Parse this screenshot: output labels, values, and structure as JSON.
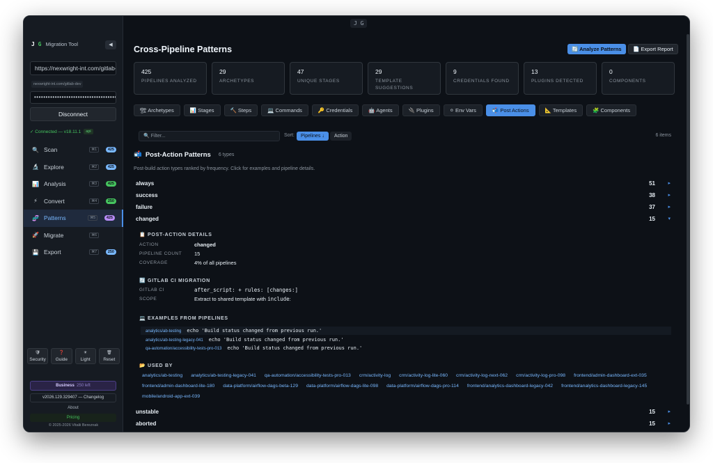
{
  "window": {
    "badge": "J G"
  },
  "sidebar": {
    "brand_logo_j": "J",
    "brand_logo_g": "G",
    "brand_name": "Migration Tool",
    "collapse": "◀",
    "url_value": "https://nexwright-int.com/gitlab-dev",
    "url_hint": "nexwright-int.com/gitlab-dev",
    "token_value": "•••••••••••••••••••••••••••••••••••••",
    "disconnect_label": "Disconnect",
    "status_text": "✓ Connected — v18.11.1",
    "status_badge": "api",
    "items": [
      {
        "label": "Scan",
        "icon": "🔍",
        "kbd": "⌘1",
        "count": "425",
        "color": "#79b8ff"
      },
      {
        "label": "Explore",
        "icon": "🔬",
        "kbd": "⌘2",
        "count": "425",
        "color": "#79b8ff"
      },
      {
        "label": "Analysis",
        "icon": "📊",
        "kbd": "⌘3",
        "count": "425",
        "color": "#46c45f"
      },
      {
        "label": "Convert",
        "icon": "⚡",
        "kbd": "⌘4",
        "count": "250",
        "color": "#46c45f"
      },
      {
        "label": "Patterns",
        "icon": "🧬",
        "kbd": "⌘5",
        "count": "425",
        "color": "#b78cf7"
      },
      {
        "label": "Migrate",
        "icon": "🚀",
        "kbd": "⌘6",
        "count": "",
        "color": ""
      },
      {
        "label": "Export",
        "icon": "💾",
        "kbd": "⌘7",
        "count": "250",
        "color": "#79b8ff"
      }
    ],
    "tools": [
      {
        "icon": "🛡",
        "label": "Security"
      },
      {
        "icon": "❓",
        "label": "Guide"
      },
      {
        "icon": "☀",
        "label": "Light"
      },
      {
        "icon": "🗑",
        "label": "Reset"
      }
    ],
    "plan_name": "Business",
    "plan_left": "250 left",
    "version": "v2026.129.329407 — Changelog",
    "about": "About",
    "pricing": "Pricing",
    "copyright": "© 2025-2026 Vitalii Bereznak"
  },
  "header": {
    "title": "Cross-Pipeline Patterns",
    "analyze_label": "🔄 Analyze Patterns",
    "export_label": "📄 Export Report"
  },
  "stats": [
    {
      "value": "425",
      "label": "PIPELINES ANALYZED"
    },
    {
      "value": "29",
      "label": "ARCHETYPES"
    },
    {
      "value": "47",
      "label": "UNIQUE STAGES"
    },
    {
      "value": "29",
      "label": "TEMPLATE SUGGESTIONS"
    },
    {
      "value": "9",
      "label": "CREDENTIALS FOUND"
    },
    {
      "value": "13",
      "label": "PLUGINS DETECTED"
    },
    {
      "value": "0",
      "label": "COMPONENTS"
    }
  ],
  "tabs": [
    {
      "label": "🏗 Archetypes"
    },
    {
      "label": "📊 Stages"
    },
    {
      "label": "🔨 Steps"
    },
    {
      "label": "💻 Commands"
    },
    {
      "label": "🔑 Credentials"
    },
    {
      "label": "🤖 Agents"
    },
    {
      "label": "🔌 Plugins"
    },
    {
      "label": "⚪ Env Vars"
    },
    {
      "label": "📬 Post Actions"
    },
    {
      "label": "📐 Templates"
    },
    {
      "label": "🧩 Components"
    }
  ],
  "filter": {
    "placeholder": "🔍 Filter...",
    "sort_label": "Sort:",
    "sort_pipelines": "Pipelines ↓",
    "sort_action": "Action",
    "item_count": "6 items"
  },
  "section": {
    "title": "Post-Action Patterns",
    "icon": "📬",
    "types": "6 types",
    "subtitle": "Post-build action types ranked by frequency. Click for examples and pipeline details."
  },
  "rows": [
    {
      "name": "always",
      "count": "51",
      "chevron": "▸"
    },
    {
      "name": "success",
      "count": "38",
      "chevron": "▸"
    },
    {
      "name": "failure",
      "count": "37",
      "chevron": "▸"
    },
    {
      "name": "changed",
      "count": "15",
      "chevron": "▾"
    },
    {
      "name": "unstable",
      "count": "15",
      "chevron": "▸"
    },
    {
      "name": "aborted",
      "count": "15",
      "chevron": "▸"
    }
  ],
  "details": {
    "post_action_head": "📋 POST-ACTION DETAILS",
    "action_label": "ACTION",
    "action_value": "changed",
    "pipeline_count_label": "PIPELINE COUNT",
    "pipeline_count_value": "15",
    "coverage_label": "COVERAGE",
    "coverage_value": "4% of all pipelines",
    "gitlab_head": "🔄 GITLAB CI MIGRATION",
    "gitlab_ci_label": "GITLAB CI",
    "gitlab_ci_value": "after_script: + rules: [changes:]",
    "scope_label": "SCOPE",
    "scope_prefix": "Extract to shared template with ",
    "scope_code": "include",
    "scope_suffix": ":",
    "examples_head": "💻 EXAMPLES FROM PIPELINES",
    "examples": [
      {
        "path": "analytics/ab-testing",
        "cmd": "echo 'Build status changed from previous run.'"
      },
      {
        "path": "analytics/ab-testing-legacy-041",
        "cmd": "echo 'Build status changed from previous run.'"
      },
      {
        "path": "qa-automation/accessibility-tests-pro-013",
        "cmd": "echo 'Build status changed from previous run.'"
      }
    ],
    "used_by_head": "📂 USED BY",
    "used_by": [
      "analytics/ab-testing",
      "analytics/ab-testing-legacy-041",
      "qa-automation/accessibility-tests-pro-013",
      "crm/activity-log",
      "crm/activity-log-lite-060",
      "crm/activity-log-next-062",
      "crm/activity-log-pro-098",
      "frontend/admin-dashboard-ext-035",
      "frontend/admin-dashboard-lite-180",
      "data-platform/airflow-dags-beta-129",
      "data-platform/airflow-dags-lite-098",
      "data-platform/airflow-dags-pro-114",
      "frontend/analytics-dashboard-legacy-042",
      "frontend/analytics-dashboard-legacy-145",
      "mobile/android-app-ext-039"
    ]
  }
}
